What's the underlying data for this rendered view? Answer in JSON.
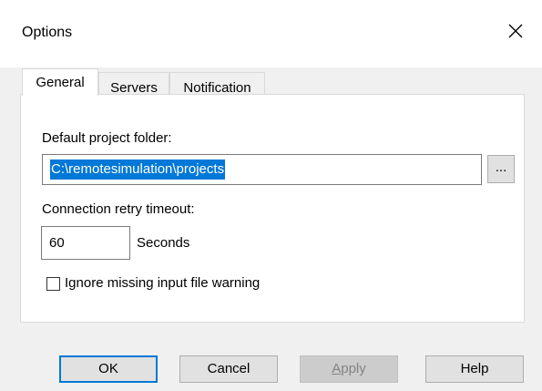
{
  "window": {
    "title": "Options",
    "close_icon": "close-icon"
  },
  "tabs": [
    {
      "label": "General",
      "active": true
    },
    {
      "label": "Servers",
      "active": false
    },
    {
      "label": "Notification",
      "active": false
    }
  ],
  "general": {
    "project_folder_label": "Default project folder:",
    "project_folder_value": "C:\\remotesimulation\\projects",
    "browse_label": "...",
    "retry_label": "Connection retry timeout:",
    "retry_value": "60",
    "retry_unit": "Seconds",
    "ignore_warning_label": "Ignore missing input file warning",
    "ignore_warning_checked": false
  },
  "buttons": {
    "ok": "OK",
    "cancel": "Cancel",
    "apply": "Apply",
    "help": "Help"
  },
  "colors": {
    "selection": "#0078d7",
    "default_button_border": "#0078d7"
  }
}
